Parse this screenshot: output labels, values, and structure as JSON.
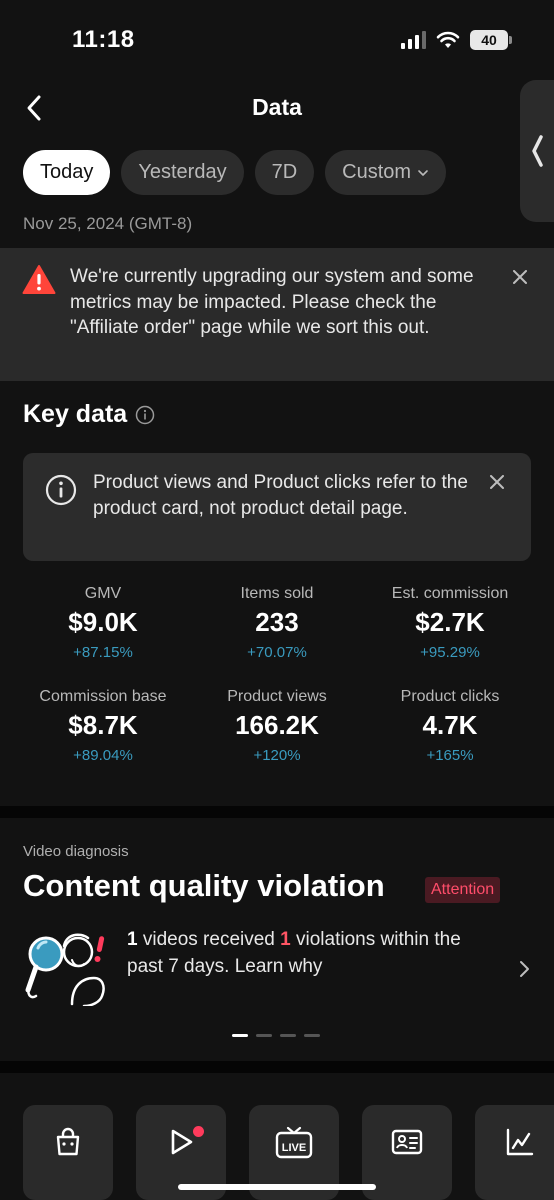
{
  "status_bar": {
    "time": "11:18",
    "battery": "40"
  },
  "header": {
    "title": "Data"
  },
  "tabs": [
    {
      "label": "Today",
      "active": true
    },
    {
      "label": "Yesterday",
      "active": false
    },
    {
      "label": "7D",
      "active": false
    },
    {
      "label": "Custom",
      "active": false
    }
  ],
  "date_label": "Nov 25, 2024 (GMT-8)",
  "warning": {
    "text": "We're currently upgrading our system and some metrics may be impacted. Please check the \"Affiliate order\" page while we sort this out."
  },
  "key_data": {
    "title": "Key data",
    "info": "Product views and Product clicks refer to the product card, not product detail page.",
    "metrics": [
      {
        "label": "GMV",
        "value": "$9.0K",
        "change": "+87.15%"
      },
      {
        "label": "Items sold",
        "value": "233",
        "change": "+70.07%"
      },
      {
        "label": "Est. commission",
        "value": "$2.7K",
        "change": "+95.29%"
      },
      {
        "label": "Commission base",
        "value": "$8.7K",
        "change": "+89.04%"
      },
      {
        "label": "Product views",
        "value": "166.2K",
        "change": "+120%"
      },
      {
        "label": "Product clicks",
        "value": "4.7K",
        "change": "+165%"
      }
    ]
  },
  "diagnosis": {
    "caption": "Video diagnosis",
    "title": "Content quality violation",
    "badge": "Attention",
    "count_videos": "1",
    "text_a": " videos received ",
    "count_violations": "1",
    "text_b": " violations within the past 7 days. Learn why"
  },
  "bottom_nav": [
    {
      "icon": "shopping-bag-icon"
    },
    {
      "icon": "play-icon"
    },
    {
      "icon": "live-icon",
      "label": "LIVE"
    },
    {
      "icon": "id-card-icon"
    },
    {
      "icon": "line-chart-icon"
    }
  ],
  "colors": {
    "background": "#121212",
    "accent_blue": "#3a9bbf",
    "alert_red": "#ff5564",
    "warning_red": "#ff453a"
  }
}
